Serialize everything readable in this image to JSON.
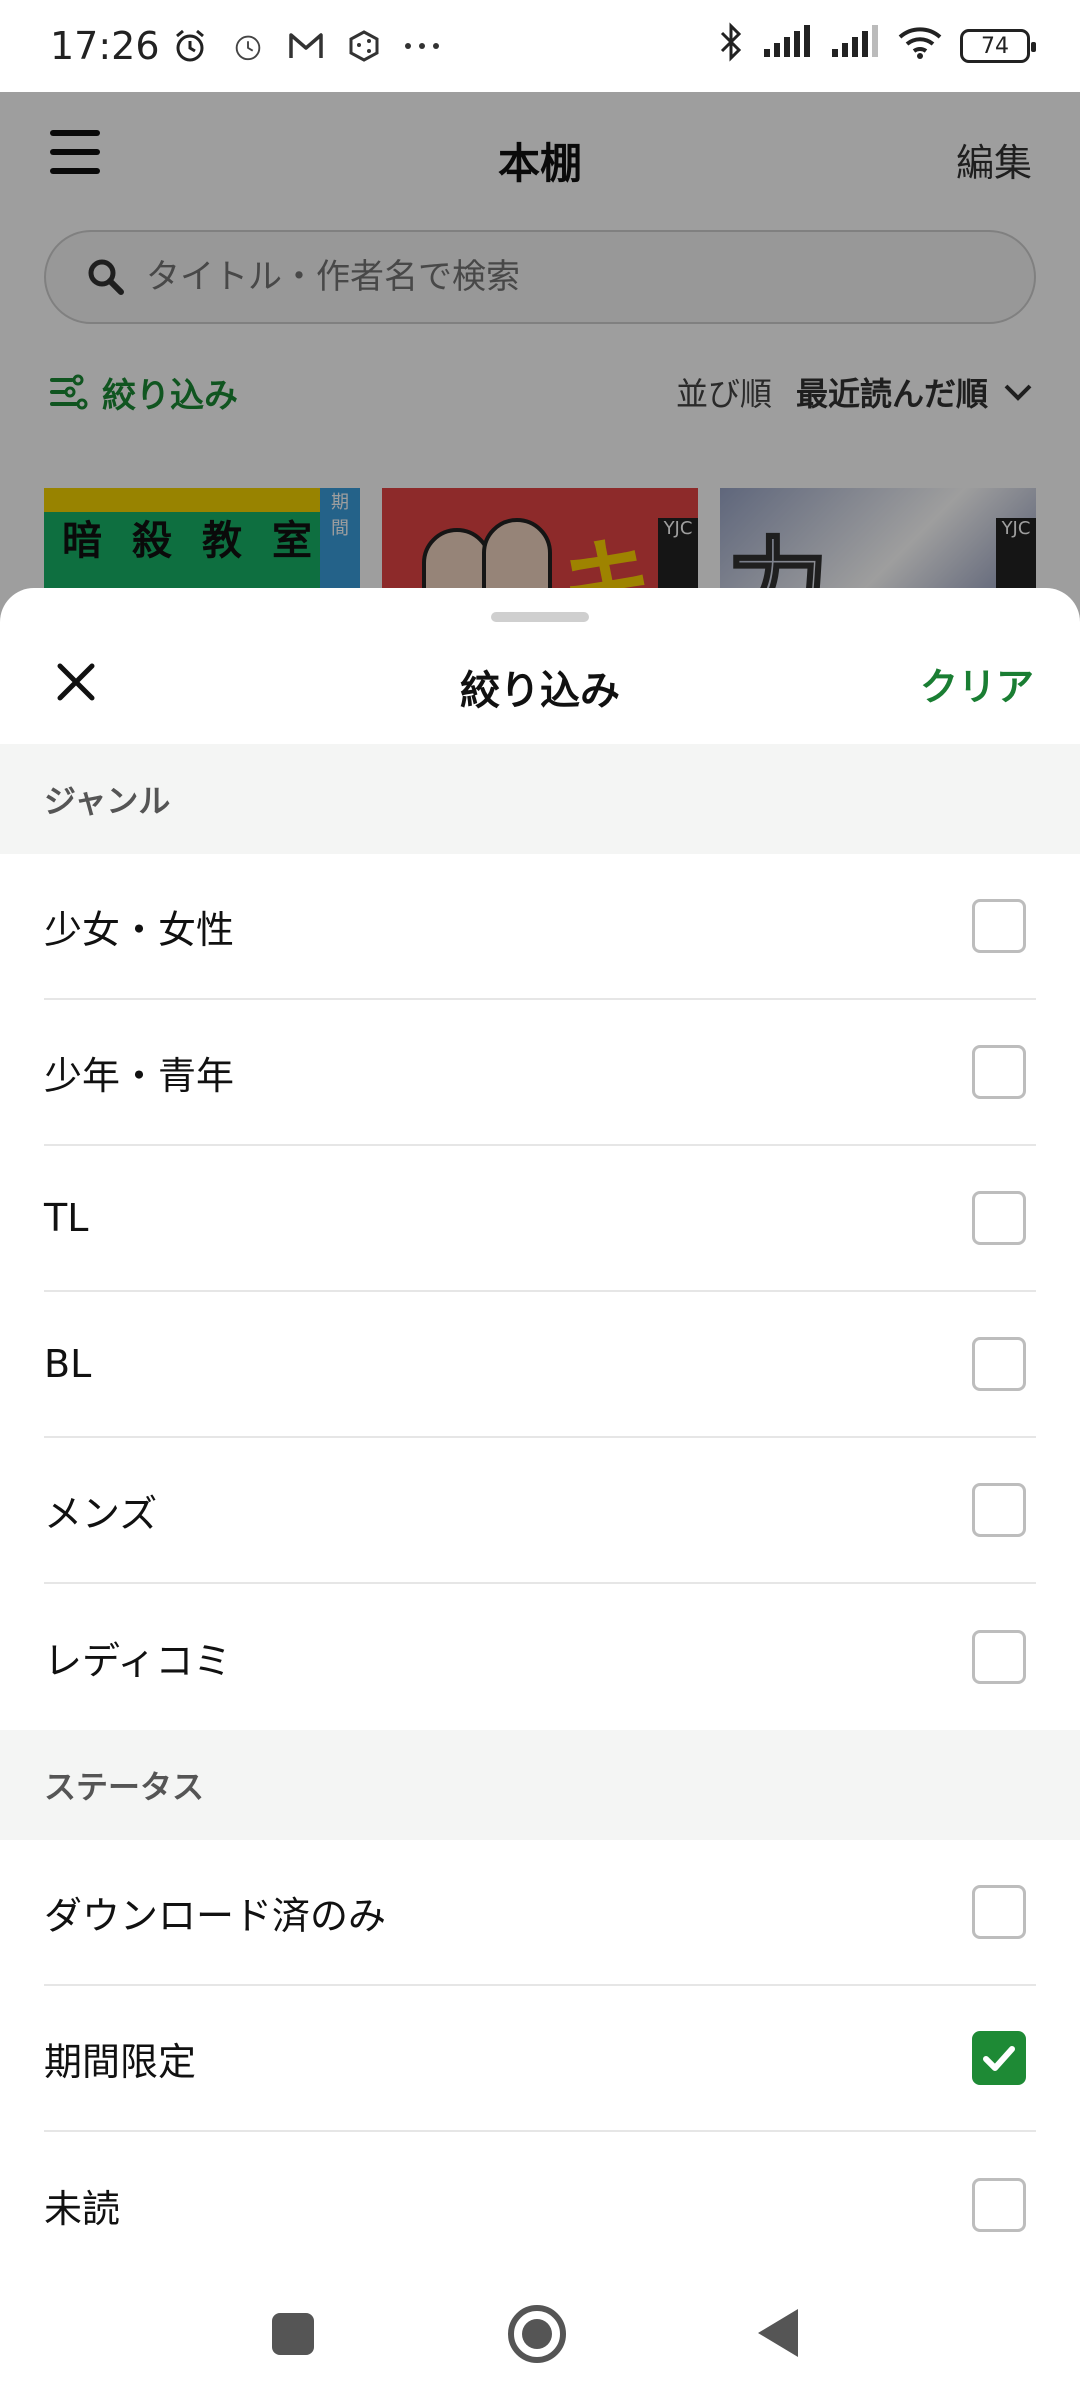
{
  "status_bar": {
    "time": "17:26",
    "battery": "74"
  },
  "app": {
    "title": "本棚",
    "edit": "編集",
    "search_placeholder": "タイトル・作者名で検索",
    "filter": "絞り込み",
    "sort_label": "並び順",
    "sort_value": "最近読んだ順",
    "books": [
      {
        "cover_text": "暗殺教室"
      },
      {
        "cover_text": "キ",
        "side": "YJC"
      },
      {
        "cover_text": "力",
        "side": "YJC"
      }
    ]
  },
  "sheet": {
    "title": "絞り込み",
    "clear": "クリア",
    "sections": [
      {
        "header": "ジャンル",
        "items": [
          {
            "label": "少女・女性",
            "checked": false
          },
          {
            "label": "少年・青年",
            "checked": false
          },
          {
            "label": "TL",
            "checked": false
          },
          {
            "label": "BL",
            "checked": false
          },
          {
            "label": "メンズ",
            "checked": false
          },
          {
            "label": "レディコミ",
            "checked": false
          }
        ]
      },
      {
        "header": "ステータス",
        "items": [
          {
            "label": "ダウンロード済のみ",
            "checked": false
          },
          {
            "label": "期間限定",
            "checked": true
          },
          {
            "label": "未読",
            "checked": false
          }
        ]
      }
    ]
  },
  "colors": {
    "accent": "#1e8a35",
    "scrim": "rgba(0,0,0,0.38)"
  }
}
